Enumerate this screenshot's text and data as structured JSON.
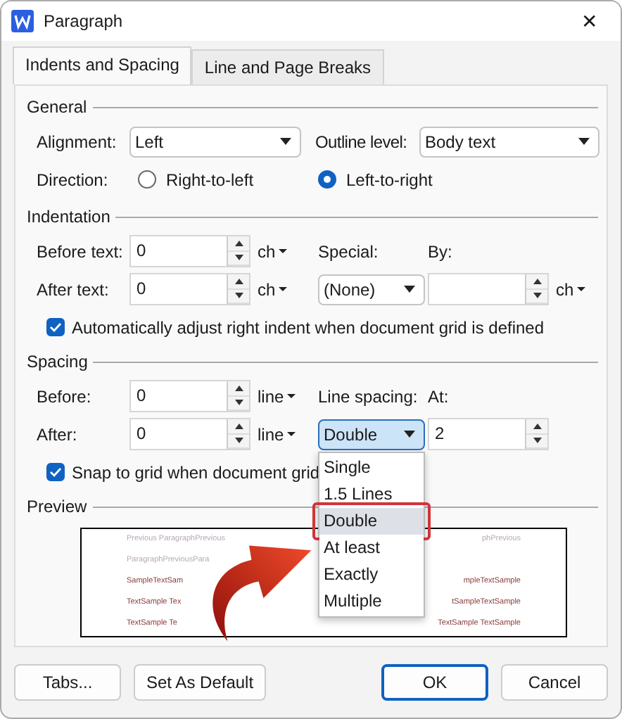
{
  "window": {
    "title": "Paragraph",
    "close": "✕"
  },
  "tabs": [
    {
      "label": "Indents and Spacing",
      "selected": true
    },
    {
      "label": "Line and Page Breaks",
      "selected": false
    }
  ],
  "general": {
    "title": "General",
    "alignment": {
      "label": "Alignment:",
      "value": "Left"
    },
    "outline_level": {
      "label": "Outline level:",
      "value": "Body text"
    },
    "direction": {
      "label": "Direction:",
      "options": [
        {
          "label": "Right-to-left",
          "selected": false
        },
        {
          "label": "Left-to-right",
          "selected": true
        }
      ]
    }
  },
  "indentation": {
    "title": "Indentation",
    "before_text": {
      "label": "Before text:",
      "value": "0",
      "unit": "ch"
    },
    "after_text": {
      "label": "After text:",
      "value": "0",
      "unit": "ch"
    },
    "special": {
      "label": "Special:",
      "value": "(None)"
    },
    "by": {
      "label": "By:",
      "unit": "ch"
    },
    "auto_adjust": {
      "label": "Automatically adjust right indent when document grid is defined",
      "checked": true
    }
  },
  "spacing": {
    "title": "Spacing",
    "before": {
      "label": "Before:",
      "value": "0",
      "unit": "line"
    },
    "after": {
      "label": "After:",
      "value": "0",
      "unit": "line"
    },
    "line_spacing": {
      "label": "Line spacing:",
      "value": "Double",
      "options": [
        {
          "label": "Single",
          "selected": false,
          "highlighted": false
        },
        {
          "label": "1.5 Lines",
          "selected": false,
          "highlighted": false
        },
        {
          "label": "Double",
          "selected": true,
          "highlighted": true
        },
        {
          "label": "At least",
          "selected": false,
          "highlighted": false
        },
        {
          "label": "Exactly",
          "selected": false,
          "highlighted": false
        },
        {
          "label": "Multiple",
          "selected": false,
          "highlighted": false
        }
      ]
    },
    "at": {
      "label": "At:",
      "value": "2"
    },
    "snap": {
      "label": "Snap to grid when document grid",
      "checked": true
    }
  },
  "preview": {
    "title": "Preview",
    "lines": [
      {
        "kind": "previous",
        "left": "Previous ParagraphPrevious",
        "right": "phPrevious"
      },
      {
        "kind": "previous",
        "left": "ParagraphPreviousPara"
      },
      {
        "kind": "sample",
        "left": "SampleTextSam",
        "right": "mpleTextSample"
      },
      {
        "kind": "sample",
        "left": "TextSample Tex",
        "right": "tSampleTextSample"
      },
      {
        "kind": "sample",
        "left": "TextSample Te",
        "right": "TextSample TextSample"
      }
    ]
  },
  "buttons": [
    {
      "label": "Tabs...",
      "default": false
    },
    {
      "label": "Set As Default",
      "default": false
    },
    {
      "label": "OK",
      "default": true
    },
    {
      "label": "Cancel",
      "default": false
    }
  ]
}
